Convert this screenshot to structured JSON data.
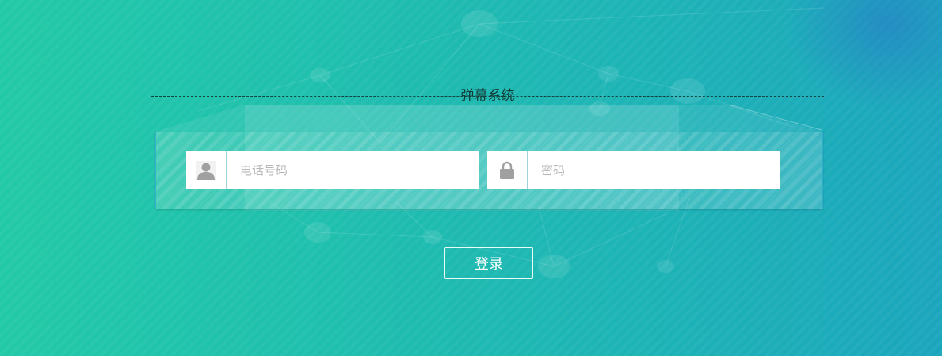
{
  "login": {
    "title": "弹幕系统",
    "phone_field": {
      "icon": "user-icon",
      "placeholder": "电话号码",
      "value": ""
    },
    "password_field": {
      "icon": "lock-icon",
      "placeholder": "密码",
      "value": ""
    },
    "submit_label": "登录"
  },
  "colors": {
    "background_start": "#22c9a7",
    "background_end": "#1ca6bd",
    "panel_border": "#28aad2",
    "icon_gray": "#a0a0a0"
  }
}
